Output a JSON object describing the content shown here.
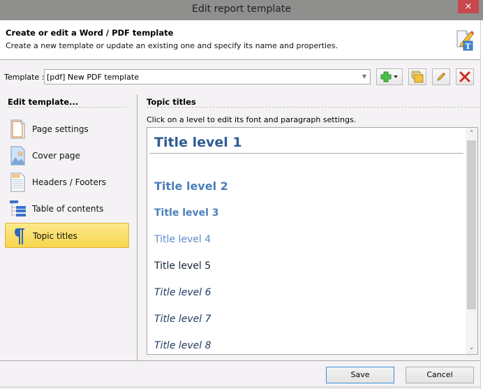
{
  "window": {
    "title": "Edit report template",
    "close_glyph": "×"
  },
  "header": {
    "title": "Create or edit a Word / PDF template",
    "subtitle": "Create a new template or update an existing one and specify its name and properties.",
    "icon": "edit-template-icon"
  },
  "template_row": {
    "label": "Template :",
    "selected": "[pdf] New PDF template",
    "buttons": [
      {
        "name": "add-template-button",
        "icon": "plus-dropdown-icon"
      },
      {
        "name": "open-template-button",
        "icon": "folder-icon"
      },
      {
        "name": "rename-template-button",
        "icon": "pencil-icon"
      },
      {
        "name": "delete-template-button",
        "icon": "red-x-icon"
      }
    ]
  },
  "sidebar": {
    "heading": "Edit template...",
    "items": [
      {
        "label": "Page settings",
        "icon": "page-icon",
        "active": false
      },
      {
        "label": "Cover page",
        "icon": "image-page-icon",
        "active": false
      },
      {
        "label": "Headers / Footers",
        "icon": "header-footer-icon",
        "active": false
      },
      {
        "label": "Table of contents",
        "icon": "toc-tree-icon",
        "active": false
      },
      {
        "label": "Topic titles",
        "icon": "pilcrow-icon",
        "active": true
      }
    ]
  },
  "main": {
    "heading": "Topic titles",
    "description": "Click on a level to edit its font and paragraph settings.",
    "levels": [
      {
        "label": "Title level 1",
        "color": "#2f5b91"
      },
      {
        "label": "Title level 2",
        "color": "#4a7fba"
      },
      {
        "label": "Title level 3",
        "color": "#4a7fba"
      },
      {
        "label": "Title level 4",
        "color": "#5a8cc8"
      },
      {
        "label": "Title level 5",
        "color": "#17233a"
      },
      {
        "label": "Title level 6",
        "color": "#1f3a5f"
      },
      {
        "label": "Title level 7",
        "color": "#1f3a5f"
      },
      {
        "label": "Title level 8",
        "color": "#1f3a5f"
      }
    ]
  },
  "footer": {
    "save_label": "Save",
    "cancel_label": "Cancel"
  },
  "colors": {
    "titlebar": "#8f908e",
    "close": "#c7484d",
    "active_item": "#f7d54c",
    "primary_border": "#3c8fd8"
  }
}
